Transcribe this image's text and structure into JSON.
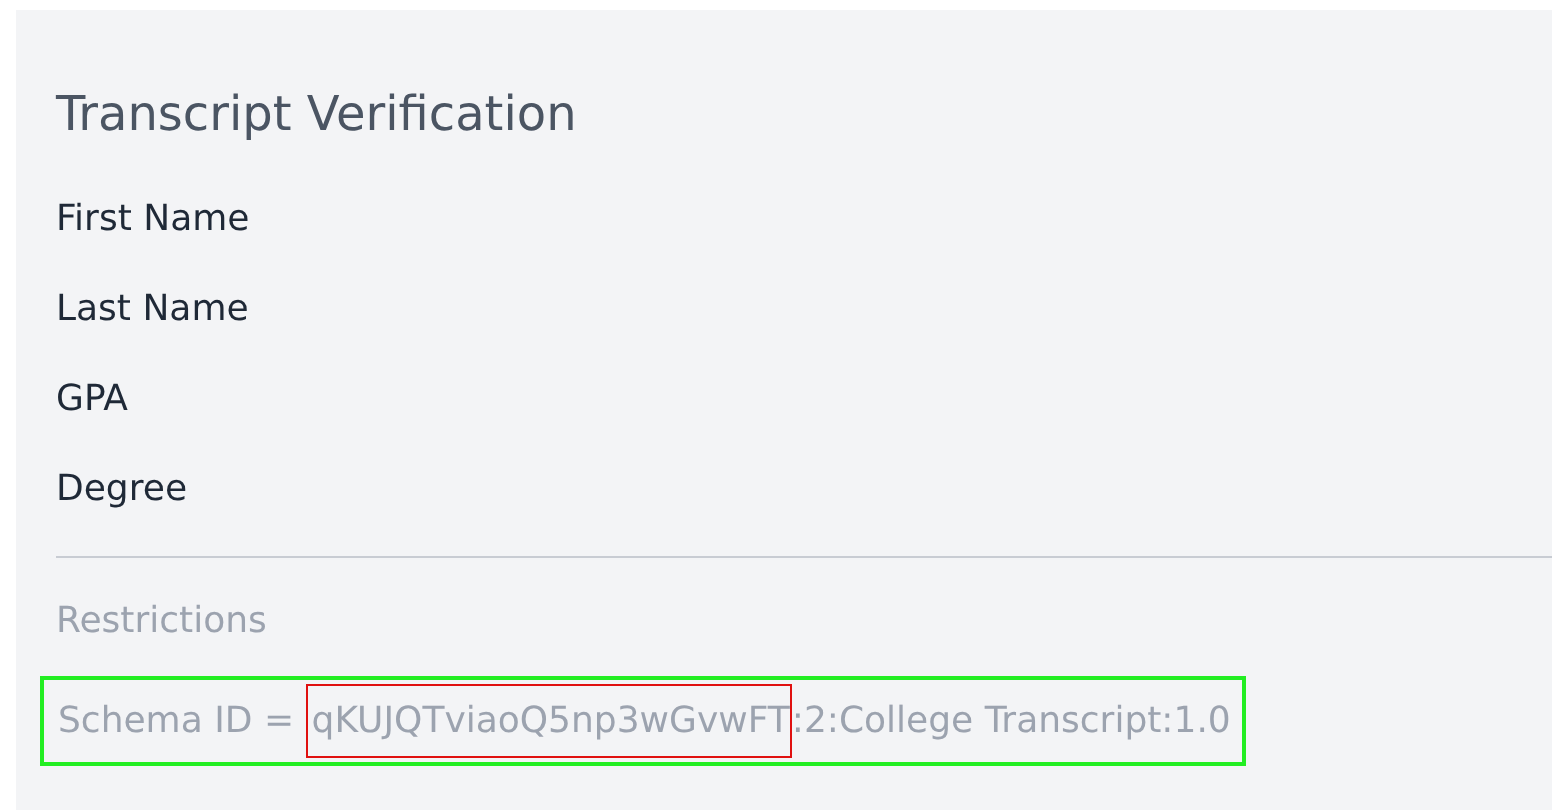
{
  "title": "Transcript Verification",
  "attributes": [
    {
      "label": "First Name"
    },
    {
      "label": "Last Name"
    },
    {
      "label": "GPA"
    },
    {
      "label": "Degree"
    }
  ],
  "restrictions": {
    "heading": "Restrictions",
    "items": [
      {
        "prefix": "Schema ID = ",
        "schema_id": "qKUJQTviaoQ5np3wGvwFT",
        "suffix": ":2:College Transcript:1.0",
        "highlighted": true,
        "id_highlighted": true
      }
    ]
  }
}
